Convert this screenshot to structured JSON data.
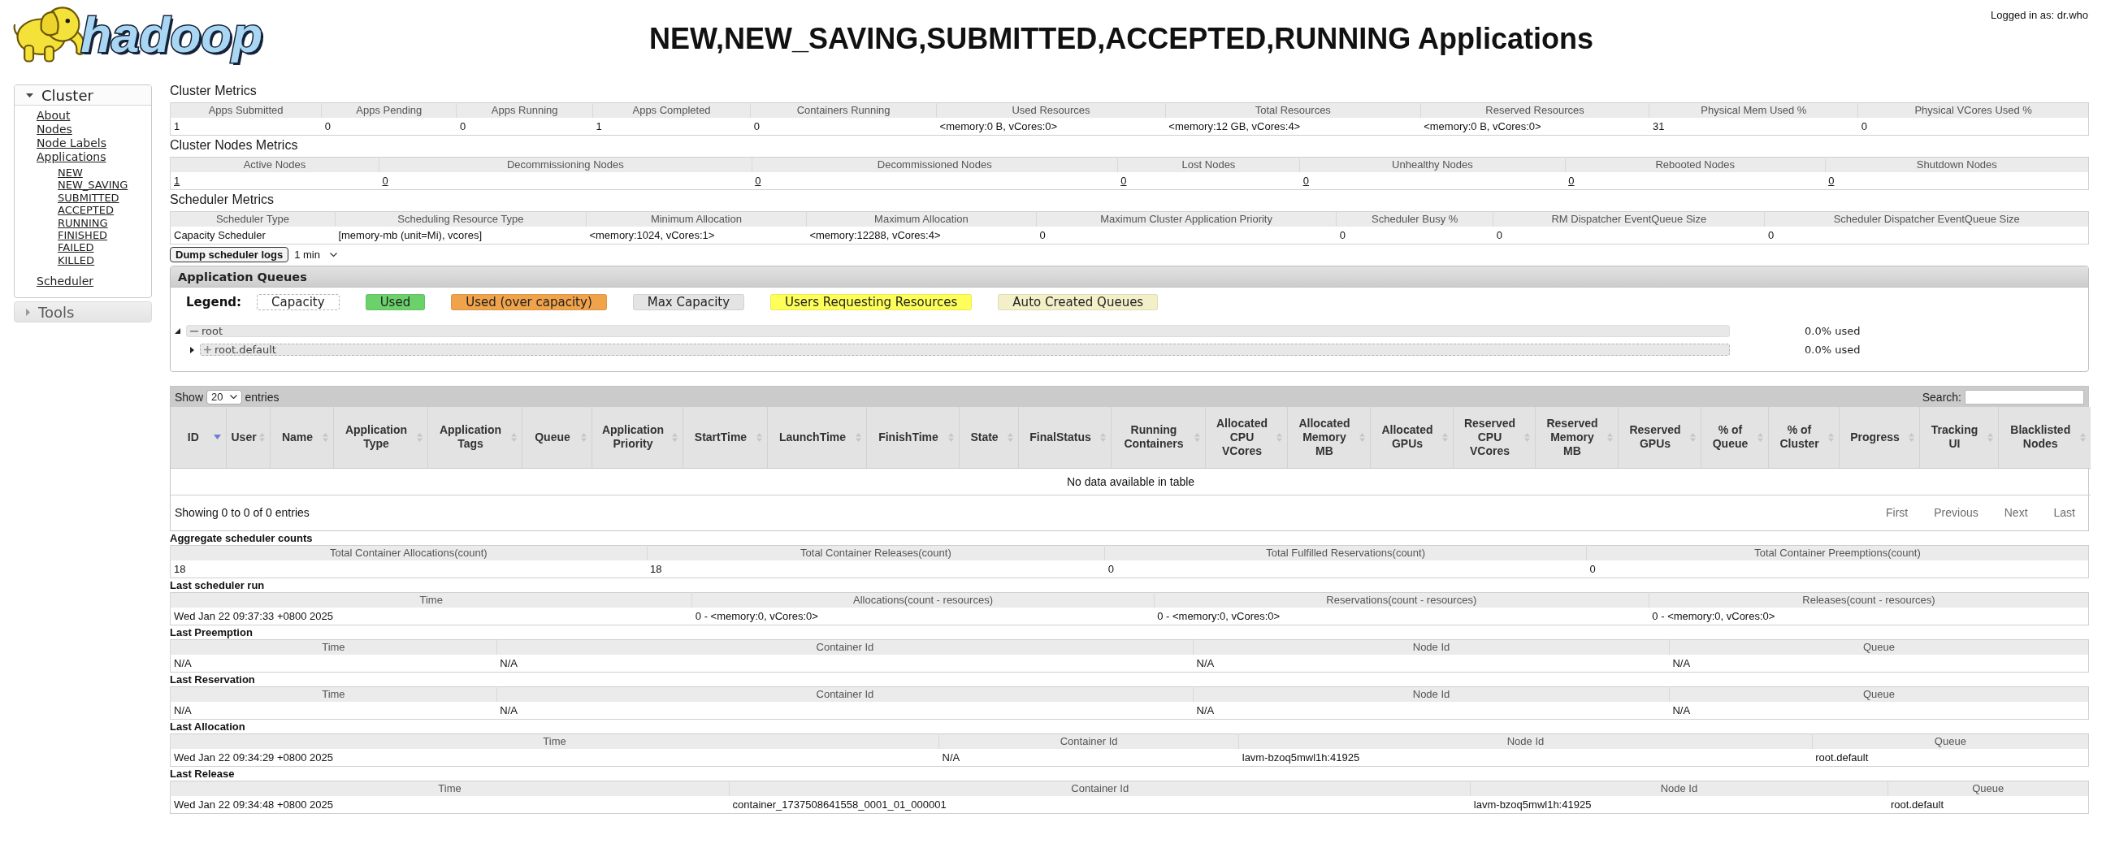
{
  "header": {
    "logo": "hadoop",
    "title": "NEW,NEW_SAVING,SUBMITTED,ACCEPTED,RUNNING Applications",
    "user_status": "Logged in as: dr.who"
  },
  "sidebar": [
    {
      "label": "Cluster",
      "expanded": true,
      "links": [
        {
          "label": "About"
        },
        {
          "label": "Nodes"
        },
        {
          "label": "Node Labels"
        },
        {
          "label": "Applications",
          "children": [
            {
              "label": "NEW"
            },
            {
              "label": "NEW_SAVING"
            },
            {
              "label": "SUBMITTED"
            },
            {
              "label": "ACCEPTED"
            },
            {
              "label": "RUNNING"
            },
            {
              "label": "FINISHED"
            },
            {
              "label": "FAILED"
            },
            {
              "label": "KILLED"
            }
          ]
        },
        {
          "label": "Scheduler"
        }
      ]
    },
    {
      "label": "Tools",
      "expanded": false
    }
  ],
  "metrics": [
    {
      "title": "Cluster Metrics",
      "links": false,
      "columns": [
        "Apps Submitted",
        "Apps Pending",
        "Apps Running",
        "Apps Completed",
        "Containers Running",
        "Used Resources",
        "Total Resources",
        "Reserved Resources",
        "Physical Mem Used %",
        "Physical VCores Used %"
      ],
      "rows": [
        [
          "1",
          "0",
          "0",
          "1",
          "0",
          "<memory:0 B, vCores:0>",
          "<memory:12 GB, vCores:4>",
          "<memory:0 B, vCores:0>",
          "31",
          "0"
        ]
      ]
    },
    {
      "title": "Cluster Nodes Metrics",
      "links": true,
      "columns": [
        "Active Nodes",
        "Decommissioning Nodes",
        "Decommissioned Nodes",
        "Lost Nodes",
        "Unhealthy Nodes",
        "Rebooted Nodes",
        "Shutdown Nodes"
      ],
      "rows": [
        [
          "1",
          "0",
          "0",
          "0",
          "0",
          "0",
          "0"
        ]
      ]
    },
    {
      "title": "Scheduler Metrics",
      "links": false,
      "columns": [
        "Scheduler Type",
        "Scheduling Resource Type",
        "Minimum Allocation",
        "Maximum Allocation",
        "Maximum Cluster Application Priority",
        "Scheduler Busy %",
        "RM Dispatcher EventQueue Size",
        "Scheduler Dispatcher EventQueue Size"
      ],
      "rows": [
        [
          "Capacity Scheduler",
          "[memory-mb (unit=Mi), vcores]",
          "<memory:1024, vCores:1>",
          "<memory:12288, vCores:4>",
          "0",
          "0",
          "0",
          "0"
        ]
      ]
    }
  ],
  "scheduler_controls": {
    "button": "Dump scheduler logs",
    "interval": "1 min"
  },
  "queues": {
    "title": "Application Queues",
    "legend_label": "Legend:",
    "legend": [
      {
        "label": "Capacity",
        "kind": "outline",
        "color": "#ffffff"
      },
      {
        "label": "Used",
        "kind": "fill",
        "color": "#6bd16b"
      },
      {
        "label": "Used (over capacity)",
        "kind": "fill",
        "color": "#f0a34a"
      },
      {
        "label": "Max Capacity",
        "kind": "fill",
        "color": "#e4e4e4"
      },
      {
        "label": "Users Requesting Resources",
        "kind": "fill",
        "color": "#ffff5a"
      },
      {
        "label": "Auto Created Queues",
        "kind": "fill",
        "color": "#f3efc8"
      }
    ],
    "tree": [
      {
        "name": "root",
        "expanded": true,
        "usage": "0.0% used",
        "children": [
          {
            "name": "root.default",
            "expanded": false,
            "usage": "0.0% used"
          }
        ]
      }
    ]
  },
  "applications": {
    "show_label": "Show",
    "page_size": "20",
    "entries_label": "entries",
    "search_label": "Search:",
    "columns": [
      {
        "label": "ID",
        "sorted": true
      },
      {
        "label": "User",
        "sorted": false
      },
      {
        "label": "Name",
        "sorted": false
      },
      {
        "label": "Application Type",
        "sorted": false
      },
      {
        "label": "Application Tags",
        "sorted": false
      },
      {
        "label": "Queue",
        "sorted": false
      },
      {
        "label": "Application Priority",
        "sorted": false
      },
      {
        "label": "StartTime",
        "sorted": false
      },
      {
        "label": "LaunchTime",
        "sorted": false
      },
      {
        "label": "FinishTime",
        "sorted": false
      },
      {
        "label": "State",
        "sorted": false
      },
      {
        "label": "FinalStatus",
        "sorted": false
      },
      {
        "label": "Running Containers",
        "sorted": false
      },
      {
        "label": "Allocated CPU VCores",
        "sorted": false
      },
      {
        "label": "Allocated Memory MB",
        "sorted": false
      },
      {
        "label": "Allocated GPUs",
        "sorted": false
      },
      {
        "label": "Reserved CPU VCores",
        "sorted": false
      },
      {
        "label": "Reserved Memory MB",
        "sorted": false
      },
      {
        "label": "Reserved GPUs",
        "sorted": false
      },
      {
        "label": "% of Queue",
        "sorted": false
      },
      {
        "label": "% of Cluster",
        "sorted": false
      },
      {
        "label": "Progress",
        "sorted": false
      },
      {
        "label": "Tracking UI",
        "sorted": false
      },
      {
        "label": "Blacklisted Nodes",
        "sorted": false
      }
    ],
    "empty_message": "No data available in table",
    "info": "Showing 0 to 0 of 0 entries",
    "pagination": [
      {
        "label": "First",
        "disabled": true
      },
      {
        "label": "Previous",
        "disabled": true
      },
      {
        "label": "Next",
        "disabled": true
      },
      {
        "label": "Last",
        "disabled": true
      }
    ]
  },
  "scheduler_activity": [
    {
      "title": "Aggregate scheduler counts",
      "columns": [
        "Total Container Allocations(count)",
        "Total Container Releases(count)",
        "Total Fulfilled Reservations(count)",
        "Total Container Preemptions(count)"
      ],
      "rows": [
        [
          "18",
          "18",
          "0",
          "0"
        ]
      ]
    },
    {
      "title": "Last scheduler run",
      "columns": [
        "Time",
        "Allocations(count - resources)",
        "Reservations(count - resources)",
        "Releases(count - resources)"
      ],
      "rows": [
        [
          "Wed Jan 22 09:37:33 +0800 2025",
          "0 - <memory:0, vCores:0>",
          "0 - <memory:0, vCores:0>",
          "0 - <memory:0, vCores:0>"
        ]
      ]
    },
    {
      "title": "Last Preemption",
      "columns": [
        "Time",
        "Container Id",
        "Node Id",
        "Queue"
      ],
      "rows": [
        [
          "N/A",
          "N/A",
          "N/A",
          "N/A"
        ]
      ]
    },
    {
      "title": "Last Reservation",
      "columns": [
        "Time",
        "Container Id",
        "Node Id",
        "Queue"
      ],
      "rows": [
        [
          "N/A",
          "N/A",
          "N/A",
          "N/A"
        ]
      ]
    },
    {
      "title": "Last Allocation",
      "columns": [
        "Time",
        "Container Id",
        "Node Id",
        "Queue"
      ],
      "rows": [
        [
          "Wed Jan 22 09:34:29 +0800 2025",
          "N/A",
          "lavm-bzoq5mwl1h:41925",
          "root.default"
        ]
      ]
    },
    {
      "title": "Last Release",
      "columns": [
        "Time",
        "Container Id",
        "Node Id",
        "Queue"
      ],
      "rows": [
        [
          "Wed Jan 22 09:34:48 +0800 2025",
          "container_1737508641558_0001_01_000001",
          "lavm-bzoq5mwl1h:41925",
          "root.default"
        ]
      ]
    }
  ]
}
